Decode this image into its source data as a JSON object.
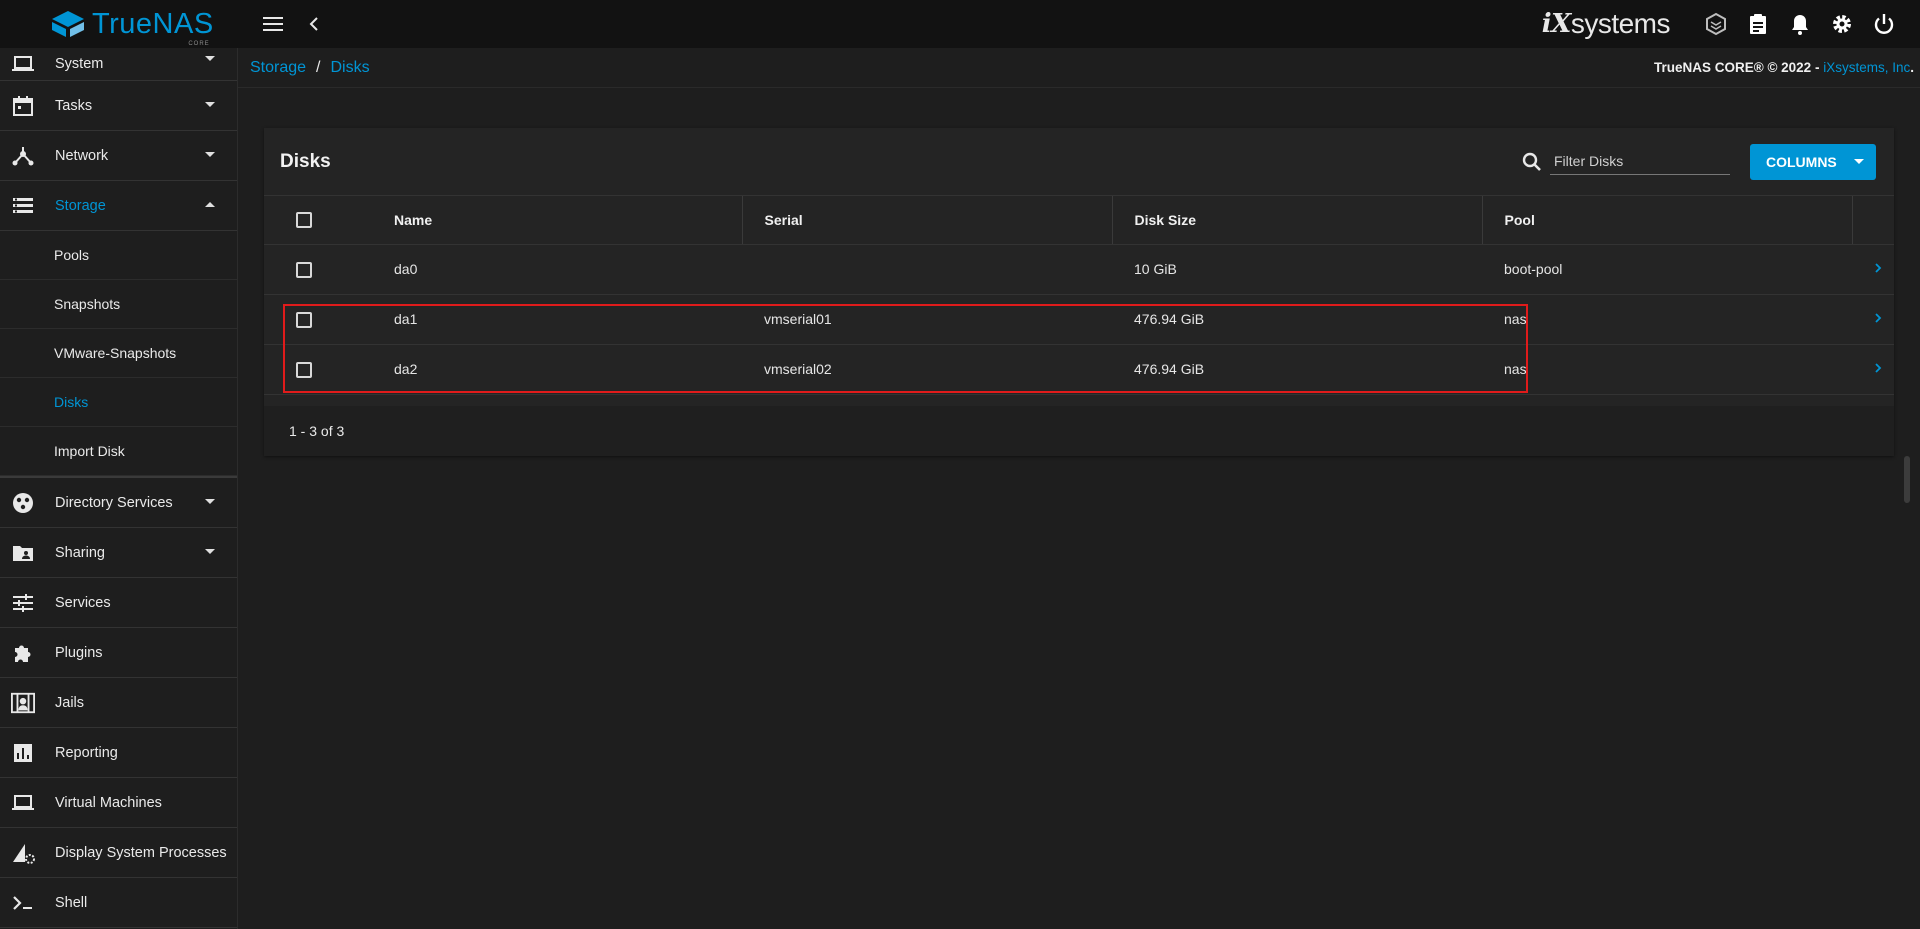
{
  "brand": {
    "name": "TrueNAS",
    "edition": "CORE",
    "vendor_ix": "iX",
    "vendor_rest": "systems"
  },
  "sidebar": {
    "items": [
      {
        "label": "System",
        "icon": "laptop-icon"
      },
      {
        "label": "Tasks",
        "icon": "calendar-icon"
      },
      {
        "label": "Network",
        "icon": "network-icon"
      },
      {
        "label": "Storage",
        "icon": "storage-icon"
      },
      {
        "label": "Directory Services",
        "icon": "directory-icon"
      },
      {
        "label": "Sharing",
        "icon": "folder-share-icon"
      },
      {
        "label": "Services",
        "icon": "sliders-icon"
      },
      {
        "label": "Plugins",
        "icon": "puzzle-icon"
      },
      {
        "label": "Jails",
        "icon": "jail-icon"
      },
      {
        "label": "Reporting",
        "icon": "chart-icon"
      },
      {
        "label": "Virtual Machines",
        "icon": "laptop-icon"
      },
      {
        "label": "Display System Processes",
        "icon": "processes-icon"
      },
      {
        "label": "Shell",
        "icon": "terminal-icon"
      }
    ],
    "storage_sub": [
      "Pools",
      "Snapshots",
      "VMware-Snapshots",
      "Disks",
      "Import Disk"
    ]
  },
  "breadcrumb": {
    "root": "Storage",
    "sep": "/",
    "current": "Disks"
  },
  "copyright": {
    "text": "TrueNAS CORE® © 2022 - ",
    "link": "iXsystems, Inc",
    "end": "."
  },
  "card": {
    "title": "Disks",
    "filter_placeholder": "Filter Disks",
    "columns_label": "COLUMNS",
    "headers": [
      "Name",
      "Serial",
      "Disk Size",
      "Pool"
    ],
    "rows": [
      {
        "name": "da0",
        "serial": "",
        "size": "10 GiB",
        "pool": "boot-pool"
      },
      {
        "name": "da1",
        "serial": "vmserial01",
        "size": "476.94 GiB",
        "pool": "nas"
      },
      {
        "name": "da2",
        "serial": "vmserial02",
        "size": "476.94 GiB",
        "pool": "nas"
      }
    ],
    "footer": "1 - 3 of 3"
  },
  "colors": {
    "accent": "#0095d5",
    "highlight": "#e01b1b"
  }
}
